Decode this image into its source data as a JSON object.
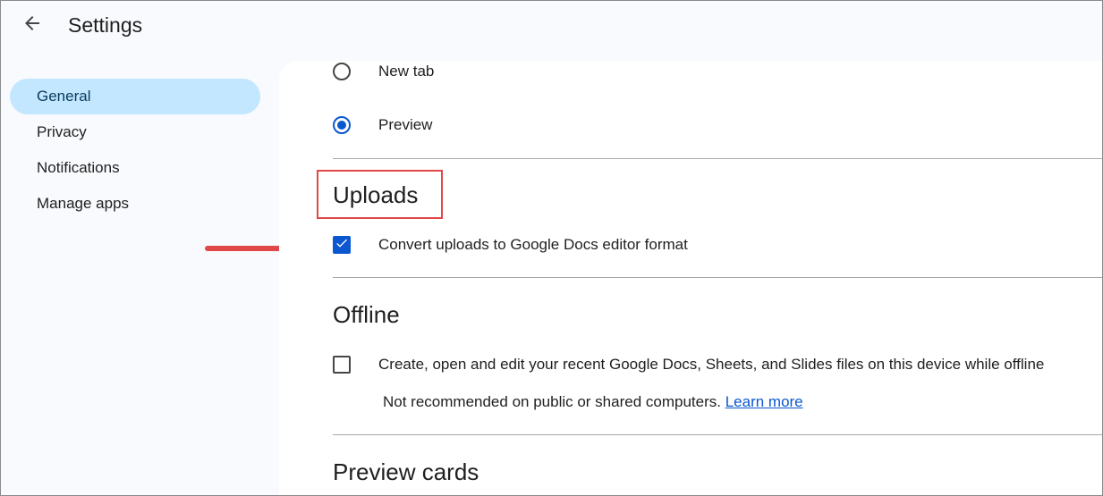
{
  "header": {
    "title": "Settings",
    "back_icon": "arrow-left-icon"
  },
  "sidebar": {
    "items": [
      {
        "label": "General",
        "active": true
      },
      {
        "label": "Privacy",
        "active": false
      },
      {
        "label": "Notifications",
        "active": false
      },
      {
        "label": "Manage apps",
        "active": false
      }
    ]
  },
  "open_mode": {
    "options": [
      {
        "label": "New tab",
        "selected": false
      },
      {
        "label": "Preview",
        "selected": true
      }
    ]
  },
  "uploads": {
    "heading": "Uploads",
    "convert_label": "Convert uploads to Google Docs editor format",
    "convert_checked": true
  },
  "offline": {
    "heading": "Offline",
    "label": "Create, open and edit your recent Google Docs, Sheets, and Slides files on this device while offline",
    "checked": false,
    "note": "Not recommended on public or shared computers.",
    "learn_more": "Learn more"
  },
  "preview_cards": {
    "heading": "Preview cards"
  },
  "colors": {
    "accent": "#0b57d0",
    "nav_active_bg": "#c2e7ff",
    "annotation_red": "#e04747",
    "page_bg": "#f8fafd"
  }
}
